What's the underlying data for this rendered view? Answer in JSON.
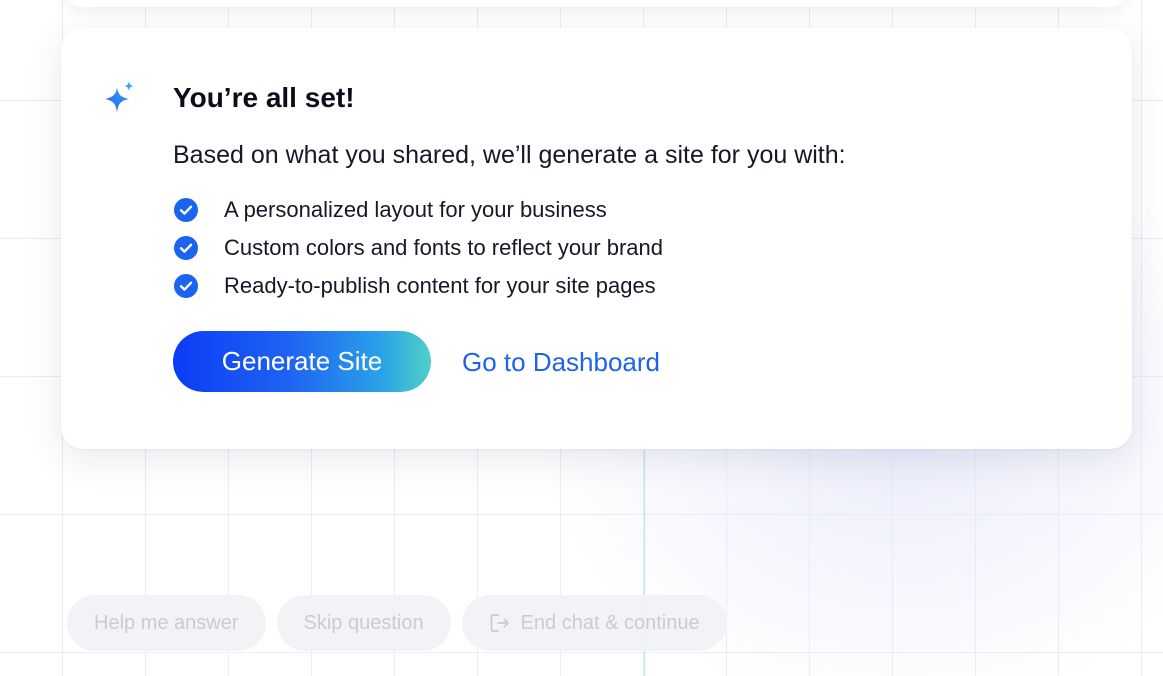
{
  "card": {
    "title": "You’re all set!",
    "subtitle": "Based on what you shared, we’ll generate a site for you with:",
    "features": [
      {
        "label": "A personalized layout for your business",
        "icon": "check-circle-icon"
      },
      {
        "label": "Custom colors and fonts to reflect your brand",
        "icon": "check-circle-icon"
      },
      {
        "label": "Ready-to-publish content for your site pages",
        "icon": "check-circle-icon"
      }
    ],
    "primary_button": "Generate Site",
    "secondary_link": "Go to Dashboard",
    "header_icon": "sparkle-icon"
  },
  "chat_actions": {
    "help": "Help me answer",
    "skip": "Skip question",
    "end": "End chat & continue",
    "end_icon": "exit-icon"
  },
  "colors": {
    "accent_blue": "#1e63e8",
    "check_blue": "#1a64f0",
    "gradient_start": "#0b3cf5",
    "gradient_end": "#4fd0c7"
  }
}
